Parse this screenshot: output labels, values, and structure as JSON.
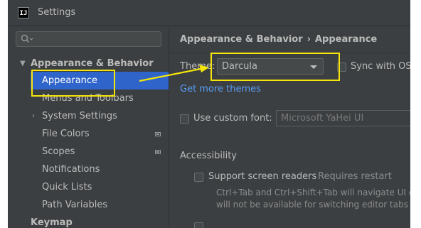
{
  "window": {
    "title": "Settings",
    "icon_text": "IJ"
  },
  "sidebar": {
    "items": [
      {
        "label": "Appearance & Behavior",
        "level": 0,
        "expanded": true,
        "bold": true
      },
      {
        "label": "Appearance",
        "level": 1,
        "selected": true
      },
      {
        "label": "Menus and Toolbars",
        "level": 1
      },
      {
        "label": "System Settings",
        "level": 1,
        "collapsed": true
      },
      {
        "label": "File Colors",
        "level": 1,
        "project_icon": true
      },
      {
        "label": "Scopes",
        "level": 1,
        "project_icon": true
      },
      {
        "label": "Notifications",
        "level": 1
      },
      {
        "label": "Quick Lists",
        "level": 1
      },
      {
        "label": "Path Variables",
        "level": 1
      },
      {
        "label": "Keymap",
        "level": 0,
        "bold": true
      }
    ]
  },
  "breadcrumb": {
    "parent": "Appearance & Behavior",
    "separator": "›",
    "current": "Appearance"
  },
  "theme": {
    "label": "Theme:",
    "value": "Darcula",
    "sync_label": "Sync with OS",
    "get_more": "Get more themes"
  },
  "font": {
    "label": "Use custom font:",
    "value": "Microsoft YaHei UI"
  },
  "accessibility": {
    "heading": "Accessibility",
    "screen_readers_label": "Support screen readers",
    "requires_restart": "Requires restart",
    "desc_line1": "Ctrl+Tab and Ctrl+Shift+Tab will navigate UI cont",
    "desc_line2": "will not be available for switching editor tabs or c"
  },
  "annotation_color": "#f5e50a",
  "accent_color": "#2f65ca",
  "link_color": "#589df6"
}
